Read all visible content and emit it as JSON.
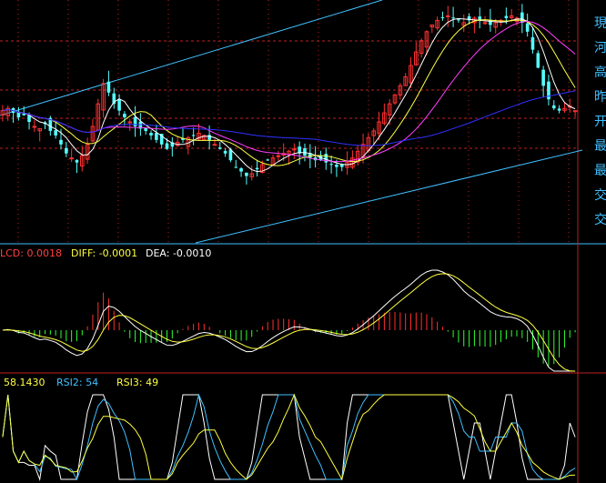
{
  "colors": {
    "background": "#000000",
    "up": "#ff3030",
    "down": "#54ffff",
    "ma5": "#ffffff",
    "ma10": "#ffff40",
    "ma20": "#ff40ff",
    "ma60": "#3030ff",
    "trend": "#40c0ff",
    "grid": "#c02020",
    "macd_pos": "#ff3030",
    "macd_neg": "#30ff30",
    "rsi1": "#ffffff",
    "rsi2": "#40c0ff",
    "rsi3": "#ffff40"
  },
  "macd_header": {
    "macd_label": "LCD: 0.0018",
    "diff_label": "DIFF: -0.0001",
    "dea_label": "DEA: -0.0010"
  },
  "rsi_header": {
    "rsi1_label": "58.1430",
    "rsi2_label": "RSI2: 54",
    "rsi3_label": "RSI3: 49"
  },
  "right_axis_glyphs": [
    "現",
    "河",
    "高",
    "昨",
    "开",
    "最",
    "最",
    "交",
    "交"
  ],
  "chart_data": [
    {
      "type": "candlestick",
      "name": "price",
      "closes": [
        55,
        56,
        54,
        52,
        53,
        50,
        48,
        47,
        49,
        46,
        44,
        40,
        36,
        34,
        32,
        35,
        40,
        48,
        58,
        67,
        63,
        58,
        55,
        52,
        50,
        48,
        47,
        46,
        44,
        42,
        40,
        38,
        39,
        41,
        42,
        43,
        44,
        45,
        44,
        42,
        40,
        38,
        36,
        33,
        30,
        28,
        26,
        27,
        29,
        31,
        33,
        34,
        35,
        36,
        37,
        38,
        36,
        35,
        34,
        33,
        33,
        32,
        31,
        30,
        30,
        32,
        34,
        37,
        40,
        43,
        46,
        50,
        54,
        58,
        62,
        66,
        70,
        75,
        81,
        86,
        90,
        93,
        95,
        96,
        97,
        96,
        95,
        94,
        95,
        96,
        95,
        94,
        93,
        94,
        95,
        96,
        97,
        96,
        94,
        90,
        82,
        74,
        66,
        60,
        56,
        55,
        56,
        57,
        55
      ],
      "ma_series": [
        {
          "key": "ma5",
          "period": 5
        },
        {
          "key": "ma10",
          "period": 10
        },
        {
          "key": "ma20",
          "period": 20
        },
        {
          "key": "ma60",
          "period": 60
        }
      ]
    },
    {
      "type": "bar+line",
      "name": "macd"
    },
    {
      "type": "line",
      "name": "rsi"
    }
  ]
}
